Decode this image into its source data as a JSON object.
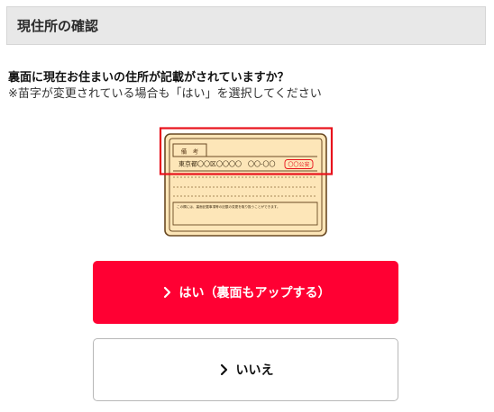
{
  "header": {
    "title": "現住所の確認"
  },
  "question": {
    "main": "裏面に現在お住まいの住所が記載がされていますか？",
    "note": "※苗字が変更されている場合も「はい」を選択してください"
  },
  "card": {
    "remarks_label": "備　考",
    "address_text": "東京都〇〇区〇〇〇〇　〇〇-〇〇",
    "stamp_text": "〇〇公安",
    "footer_text": "この欄には、裏面記載事項等の記載の変更を取り扱うことができます。",
    "highlight_color": "#e8121c",
    "card_color": "#fde6b8"
  },
  "buttons": {
    "yes_label": "はい（裏面もアップする）",
    "no_label": "いいえ",
    "yes_color": "#ff0033",
    "chevron_icon": "chevron-right-icon"
  }
}
